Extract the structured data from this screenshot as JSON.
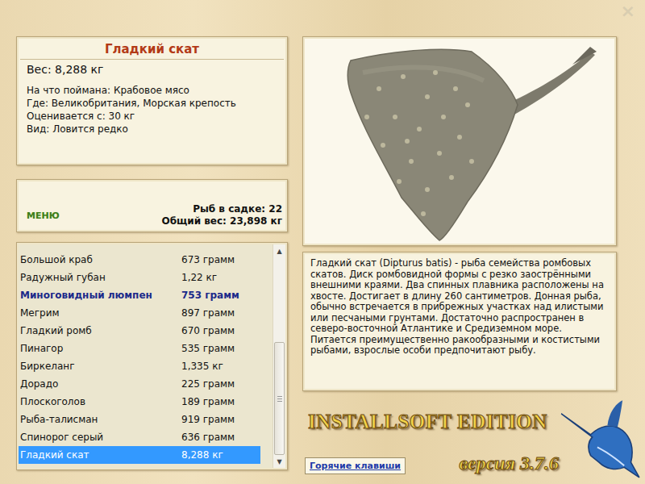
{
  "window": {
    "close": "×"
  },
  "fish_card": {
    "title": "Гладкий скат",
    "weight": "Вес: 8,288 кг",
    "details": [
      "На что поймана: Крабовое мясо",
      "Где: Великобритания, Морская крепость",
      "Оценивается с: 30 кг",
      "Вид: Ловится редко"
    ]
  },
  "menu": {
    "label": "МЕНЮ",
    "count": "Рыб в садке: 22",
    "total": "Общий вес: 23,898 кг"
  },
  "catch_list": {
    "scroll_up": "▲",
    "scroll_down": "▼",
    "scroll": {
      "level": 1
    },
    "rows": [
      {
        "name": "Большой краб",
        "weight": "673 грамм",
        "selected": false,
        "highlighted": false
      },
      {
        "name": "Радужный губан",
        "weight": "1,22 кг",
        "selected": false,
        "highlighted": false
      },
      {
        "name": "Миноговидный люмпен",
        "weight": "753 грамм",
        "selected": false,
        "highlighted": true
      },
      {
        "name": "Мегрим",
        "weight": "897 грамм",
        "selected": false,
        "highlighted": false
      },
      {
        "name": "Гладкий ромб",
        "weight": "670 грамм",
        "selected": false,
        "highlighted": false
      },
      {
        "name": "Пинагор",
        "weight": "535 грамм",
        "selected": false,
        "highlighted": false
      },
      {
        "name": "Биркеланг",
        "weight": "1,335 кг",
        "selected": false,
        "highlighted": false
      },
      {
        "name": "Дорадо",
        "weight": "225 грамм",
        "selected": false,
        "highlighted": false
      },
      {
        "name": "Плоскоголов",
        "weight": "189 грамм",
        "selected": false,
        "highlighted": false
      },
      {
        "name": "Рыба-талисман",
        "weight": "919 грамм",
        "selected": false,
        "highlighted": false
      },
      {
        "name": "Спинорог серый",
        "weight": "636 грамм",
        "selected": false,
        "highlighted": false
      },
      {
        "name": "Гладкий скат",
        "weight": "8,288 кг",
        "selected": true,
        "highlighted": false
      }
    ]
  },
  "description": "Гладкий скат (Dipturus batis) - рыба семейства ромбовых скатов. Диск ромбовидной формы с резко заострёнными внешними краями. Два спинных плавника расположены на хвосте. Достигает в длину 260 сантиметров. Донная рыба, обычно встречается в прибрежных участках над илистыми или песчаными грунтами. Достаточно распространен в северо-восточной Атлантике и Средиземном море. Питается преимущественно ракообразными и костистыми рыбами, взрослые особи предпочитают рыбу.",
  "logo": {
    "title": "INSTALLSOFT EDITION",
    "version": "версия 3.7.6"
  },
  "hotkeys_button": "Горячие клавиши"
}
